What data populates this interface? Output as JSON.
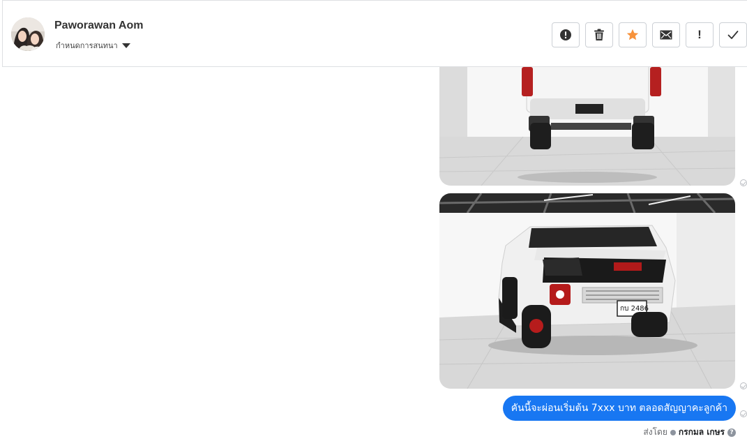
{
  "header": {
    "contact_name": "Paworawan Aom",
    "assign_label": "กำหนดการสนทนา",
    "avatar_icon": "contact-avatar",
    "actions": [
      {
        "name": "alert-button",
        "icon": "alert-circle-icon",
        "label": ""
      },
      {
        "name": "delete-button",
        "icon": "trash-icon",
        "label": ""
      },
      {
        "name": "star-button",
        "icon": "star-icon",
        "label": "",
        "color": "#f7923b"
      },
      {
        "name": "mark-unread-button",
        "icon": "envelope-icon",
        "label": ""
      },
      {
        "name": "follow-up-button",
        "icon": "exclamation-icon",
        "label": "!"
      },
      {
        "name": "done-button",
        "icon": "check-icon",
        "label": ""
      }
    ]
  },
  "conversation": {
    "images": [
      {
        "name": "truck-rear-photo",
        "plate": ""
      },
      {
        "name": "truck-front-photo",
        "plate": "กบ 2486"
      }
    ],
    "message": "คันนี้จะผ่อนเริ่มต้น 7xxx บาท ตลอดสัญญาคะลูกค้า",
    "sent_by_label": "ส่งโดย",
    "agent_name": "กรกมล เกษร",
    "help_icon": "?"
  },
  "colors": {
    "bubble": "#1877f2",
    "star": "#f7923b",
    "border": "#dddfe2"
  }
}
